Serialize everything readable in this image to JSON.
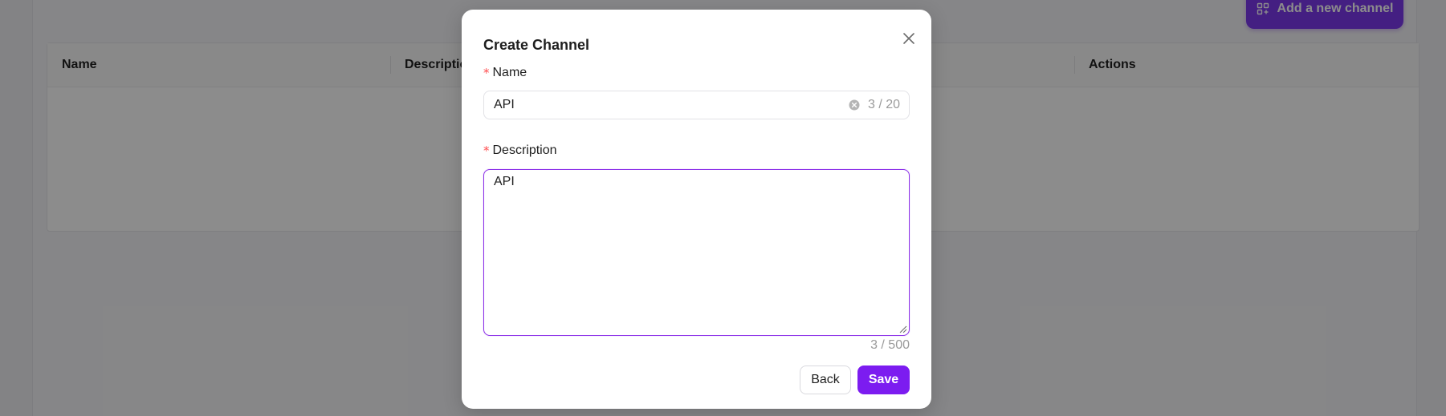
{
  "background": {
    "add_button_label": "Add a new channel",
    "table_headers": [
      "Name",
      "Description",
      "Actions"
    ]
  },
  "modal": {
    "title": "Create Channel",
    "required_mark": "*",
    "name_label": "Name",
    "name_value": "API",
    "name_count": "3 / 20",
    "description_label": "Description",
    "description_value": "API",
    "description_count": "3 / 500",
    "back_label": "Back",
    "save_label": "Save"
  },
  "colors": {
    "accent": "#7c1cf0",
    "required": "#ff4d4f",
    "focus_border": "#8b2fe8"
  },
  "icons": {
    "add_button": "add-grid-icon",
    "close": "close-icon",
    "clear": "clear-circle-icon",
    "resize": "resize-handle-icon"
  }
}
